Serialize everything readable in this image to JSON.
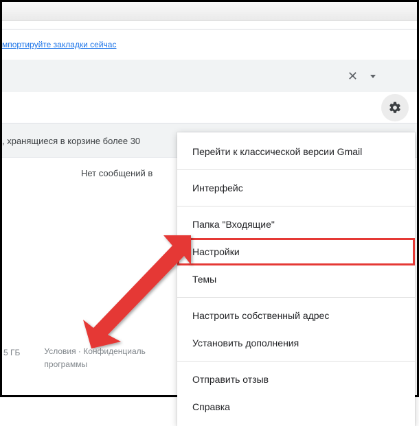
{
  "bookmarks_link": "мпортируйте закладки сейчас",
  "banner_text": ", хранящиеся в корзине более 30",
  "empty_text": "Нет сообщений в",
  "footer": {
    "storage": "5 ГБ",
    "terms_line1": "Условия · Конфиденциаль",
    "terms_line2": "программы"
  },
  "menu": {
    "classic": "Перейти к классической версии Gmail",
    "density": "Интерфейс",
    "inbox": "Папка \"Входящие\"",
    "settings": "Настройки",
    "themes": "Темы",
    "custom_address": "Настроить собственный адрес",
    "addons": "Установить дополнения",
    "feedback": "Отправить отзыв",
    "help": "Справка"
  }
}
